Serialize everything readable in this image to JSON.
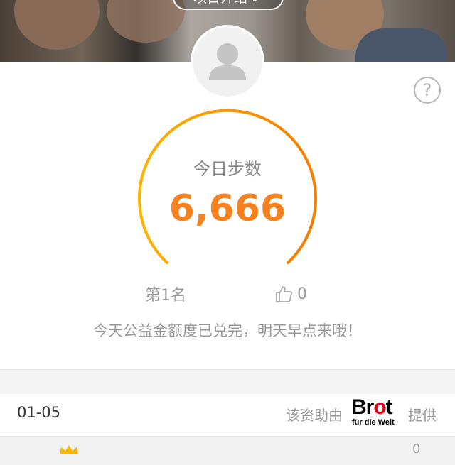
{
  "banner": {
    "button_label": "项目介绍 >"
  },
  "stats": {
    "label": "今日步数",
    "steps": "6,666",
    "rank": "第1名",
    "likes": "0"
  },
  "notice": "今天公益金额度已兑完，明天早点来哦！",
  "sponsor": {
    "date": "01-05",
    "prefix": "该资助由",
    "brand_name_b": "Br",
    "brand_name_o": "o",
    "brand_name_t": "t",
    "brand_sub": "für die Welt",
    "suffix": "提供"
  },
  "list": {
    "first_count": "0"
  },
  "colors": {
    "accent": "#f5821f",
    "gauge_start": "#ffb300",
    "gauge_end": "#f57c00"
  },
  "icons": [
    "avatar-placeholder-icon",
    "help-icon",
    "thumbs-up-icon",
    "crown-icon"
  ]
}
